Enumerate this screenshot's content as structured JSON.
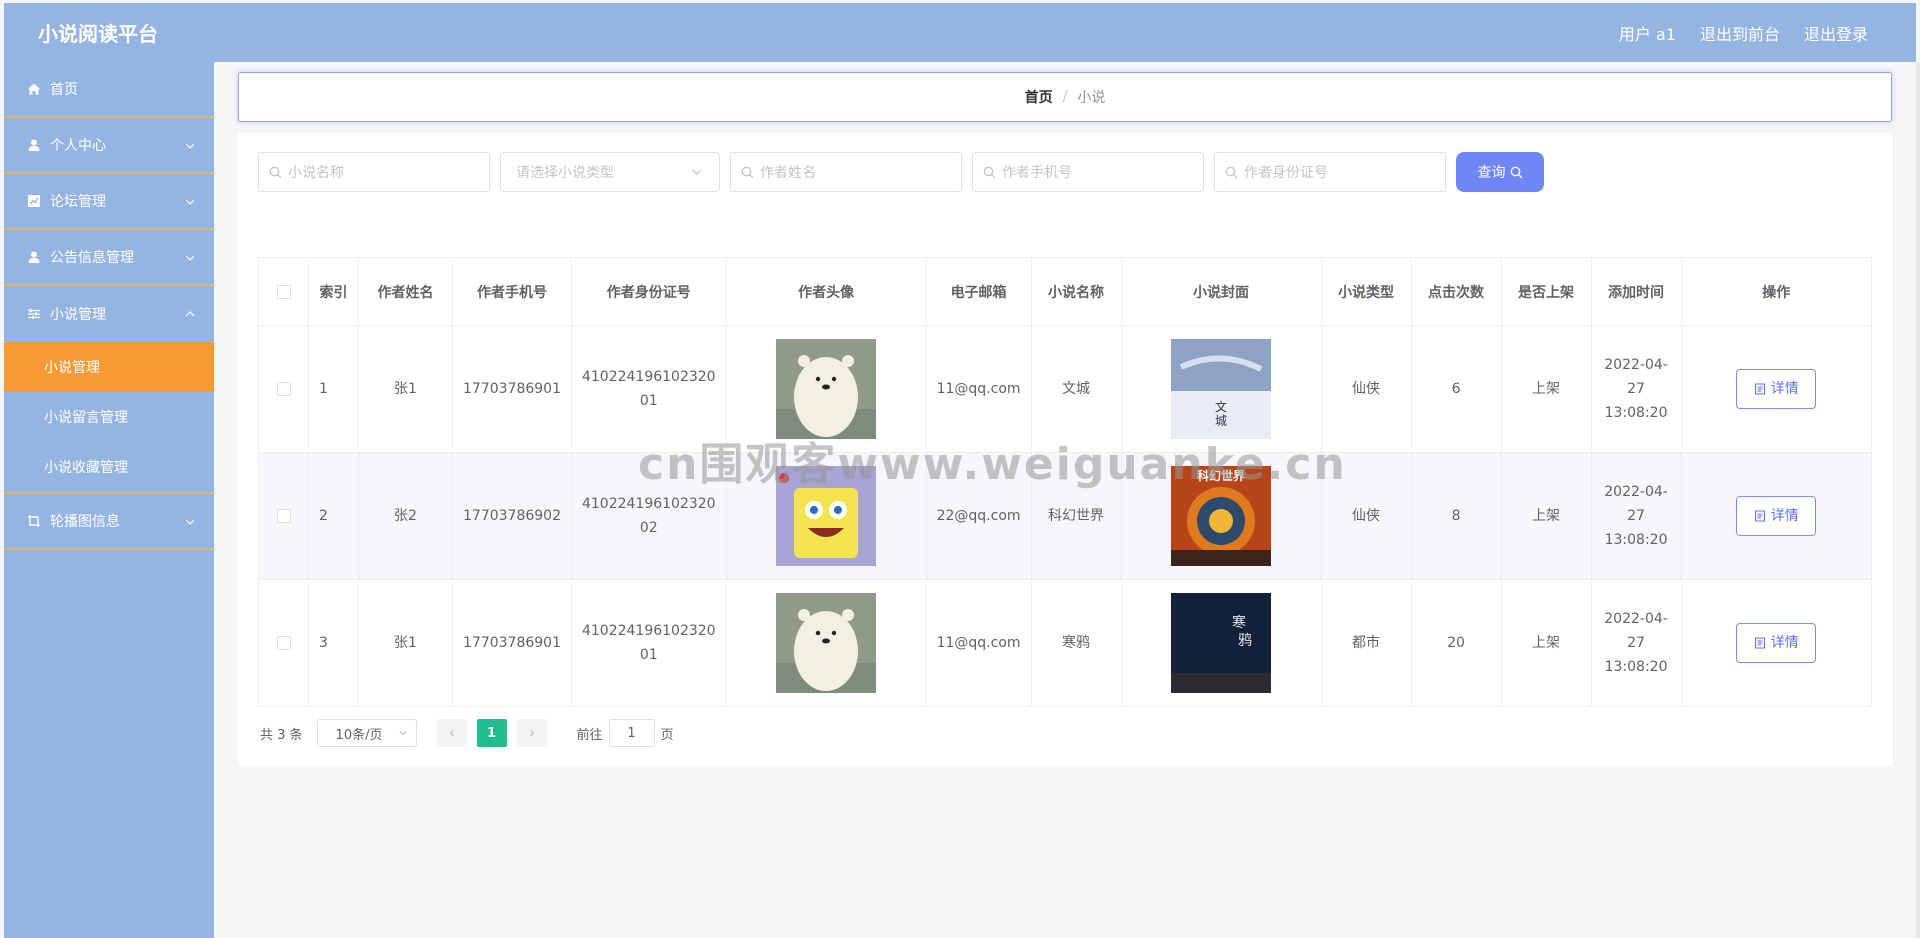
{
  "header": {
    "brand": "小说阅读平台",
    "links": [
      "用户 a1",
      "退出到前台",
      "退出登录"
    ]
  },
  "sidebar": {
    "items": [
      {
        "label": "首页",
        "icon": "home-icon"
      },
      {
        "label": "个人中心",
        "icon": "user-icon"
      },
      {
        "label": "论坛管理",
        "icon": "chart-icon"
      },
      {
        "label": "公告信息管理",
        "icon": "user-icon"
      },
      {
        "label": "小说管理",
        "icon": "sliders-icon"
      }
    ],
    "sub_items": [
      "小说管理",
      "小说留言管理",
      "小说收藏管理"
    ],
    "last_item": {
      "label": "轮播图信息",
      "icon": "crop-icon"
    }
  },
  "breadcrumb": {
    "home": "首页",
    "separator": "/",
    "current": "小说"
  },
  "search": {
    "novel_name_placeholder": "小说名称",
    "type_placeholder": "请选择小说类型",
    "author_name_placeholder": "作者姓名",
    "author_phone_placeholder": "作者手机号",
    "author_id_placeholder": "作者身份证号",
    "query_label": "查询"
  },
  "table": {
    "headers": [
      "索引",
      "作者姓名",
      "作者手机号",
      "作者身份证号",
      "作者头像",
      "电子邮箱",
      "小说名称",
      "小说封面",
      "小说类型",
      "点击次数",
      "是否上架",
      "添加时间",
      "操作"
    ],
    "rows": [
      {
        "index": "1",
        "author": "张1",
        "phone": "17703786901",
        "id_card": "410224196102320 01",
        "email": "11@qq.com",
        "novel": "文城",
        "cover_text": "文城",
        "type": "仙侠",
        "clicks": "6",
        "on_shelf": "上架",
        "added": "2022-04-27 13:08:20",
        "action": "详情"
      },
      {
        "index": "2",
        "author": "张2",
        "phone": "17703786902",
        "id_card": "410224196102320 02",
        "email": "22@qq.com",
        "novel": "科幻世界",
        "cover_text": "科幻世界",
        "type": "仙侠",
        "clicks": "8",
        "on_shelf": "上架",
        "added": "2022-04-27 13:08:20",
        "action": "详情"
      },
      {
        "index": "3",
        "author": "张1",
        "phone": "17703786901",
        "id_card": "410224196102320 01",
        "email": "11@qq.com",
        "novel": "寒鸦",
        "cover_text": "寒鸦",
        "type": "都市",
        "clicks": "20",
        "on_shelf": "上架",
        "added": "2022-04-27 13:08:20",
        "action": "详情"
      }
    ]
  },
  "pagination": {
    "total": "共 3 条",
    "page_size": "10条/页",
    "current_page": "1",
    "goto_prefix": "前往",
    "goto_value": "1",
    "goto_suffix": "页"
  },
  "watermark": "cn围观客www.weiguanke.cn",
  "colors": {
    "header_bg": "#94b5e2",
    "active_menu": "#f89b35",
    "query_btn": "#6f86f5",
    "page_active": "#1fc08e"
  }
}
